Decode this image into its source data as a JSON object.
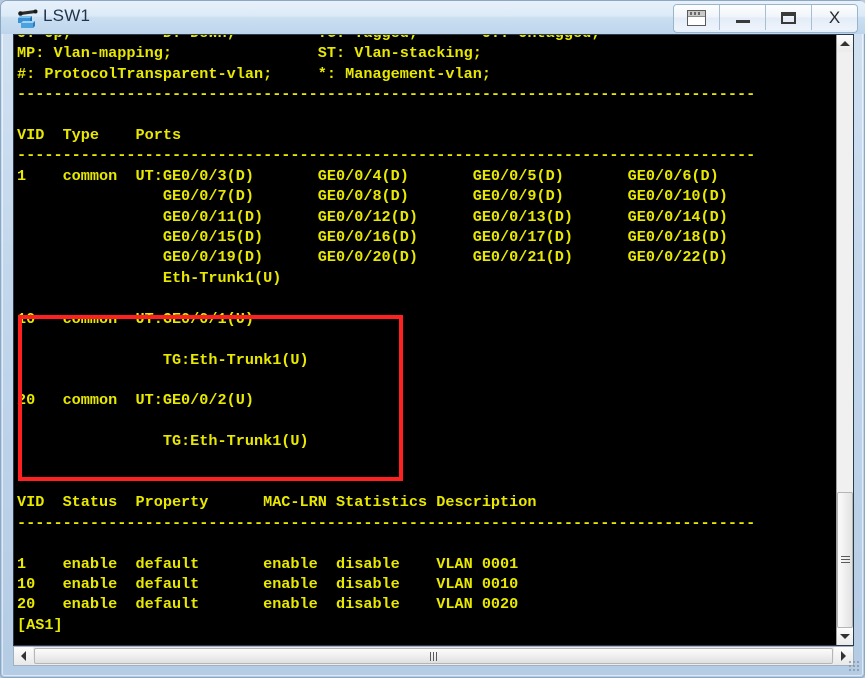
{
  "window": {
    "title": "LSW1",
    "icon": "switch-icon",
    "buttons": [
      {
        "name": "restore-window-button",
        "glyph": "restore-icon",
        "label": ""
      },
      {
        "name": "minimize-button",
        "glyph": "minimize-icon",
        "label": ""
      },
      {
        "name": "maximize-button",
        "glyph": "maximize-icon",
        "label": ""
      },
      {
        "name": "close-button",
        "glyph": "close-icon",
        "label": "X"
      }
    ]
  },
  "terminal": {
    "foreground_color": "#e8e800",
    "background_color": "#000000",
    "prompt": "[AS1]",
    "cursor_visible": true,
    "lines": [
      "U: Up;          D: Down;         TG: Tagged;       UT: Untagged;",
      "MP: Vlan-mapping;                ST: Vlan-stacking;",
      "#: ProtocolTransparent-vlan;     *: Management-vlan;",
      "---------------------------------------------------------------------------------",
      "",
      "VID  Type    Ports",
      "---------------------------------------------------------------------------------",
      "1    common  UT:GE0/0/3(D)       GE0/0/4(D)       GE0/0/5(D)       GE0/0/6(D)",
      "                GE0/0/7(D)       GE0/0/8(D)       GE0/0/9(D)       GE0/0/10(D)",
      "                GE0/0/11(D)      GE0/0/12(D)      GE0/0/13(D)      GE0/0/14(D)",
      "                GE0/0/15(D)      GE0/0/16(D)      GE0/0/17(D)      GE0/0/18(D)",
      "                GE0/0/19(D)      GE0/0/20(D)      GE0/0/21(D)      GE0/0/22(D)",
      "                Eth-Trunk1(U)",
      "",
      "10   common  UT:GE0/0/1(U)",
      "",
      "                TG:Eth-Trunk1(U)",
      "",
      "20   common  UT:GE0/0/2(U)",
      "",
      "                TG:Eth-Trunk1(U)",
      "",
      "",
      "VID  Status  Property      MAC-LRN Statistics Description",
      "---------------------------------------------------------------------------------",
      "",
      "1    enable  default       enable  disable    VLAN 0001",
      "10   enable  default       enable  disable    VLAN 0010",
      "20   enable  default       enable  disable    VLAN 0020",
      "[AS1]"
    ],
    "vlan_port_table": {
      "headers": [
        "VID",
        "Type",
        "Ports"
      ],
      "rows": [
        {
          "vid": "1",
          "type": "common",
          "ports": [
            "UT:GE0/0/3(D)",
            "GE0/0/4(D)",
            "GE0/0/5(D)",
            "GE0/0/6(D)",
            "GE0/0/7(D)",
            "GE0/0/8(D)",
            "GE0/0/9(D)",
            "GE0/0/10(D)",
            "GE0/0/11(D)",
            "GE0/0/12(D)",
            "GE0/0/13(D)",
            "GE0/0/14(D)",
            "GE0/0/15(D)",
            "GE0/0/16(D)",
            "GE0/0/17(D)",
            "GE0/0/18(D)",
            "GE0/0/19(D)",
            "GE0/0/20(D)",
            "GE0/0/21(D)",
            "GE0/0/22(D)",
            "Eth-Trunk1(U)"
          ]
        },
        {
          "vid": "10",
          "type": "common",
          "ports": [
            "UT:GE0/0/1(U)",
            "TG:Eth-Trunk1(U)"
          ]
        },
        {
          "vid": "20",
          "type": "common",
          "ports": [
            "UT:GE0/0/2(U)",
            "TG:Eth-Trunk1(U)"
          ]
        }
      ]
    },
    "vlan_status_table": {
      "headers": [
        "VID",
        "Status",
        "Property",
        "MAC-LRN",
        "Statistics",
        "Description"
      ],
      "rows": [
        [
          "1",
          "enable",
          "default",
          "enable",
          "disable",
          "VLAN 0001"
        ],
        [
          "10",
          "enable",
          "default",
          "enable",
          "disable",
          "VLAN 0010"
        ],
        [
          "20",
          "enable",
          "default",
          "enable",
          "disable",
          "VLAN 0020"
        ]
      ]
    },
    "legend": {
      "U": "Up",
      "D": "Down",
      "TG": "Tagged",
      "UT": "Untagged",
      "MP": "Vlan-mapping",
      "ST": "Vlan-stacking",
      "#": "ProtocolTransparent-vlan",
      "*": "Management-vlan"
    }
  },
  "annotation": {
    "highlight_box_color": "#ff2020",
    "highlight_target": "vlan-10-and-20-port-entries"
  },
  "scrollbars": {
    "vertical": {
      "up": "scroll-up-arrow",
      "down": "scroll-down-arrow"
    },
    "horizontal": {
      "left": "scroll-left-arrow",
      "right": "scroll-right-arrow"
    }
  }
}
